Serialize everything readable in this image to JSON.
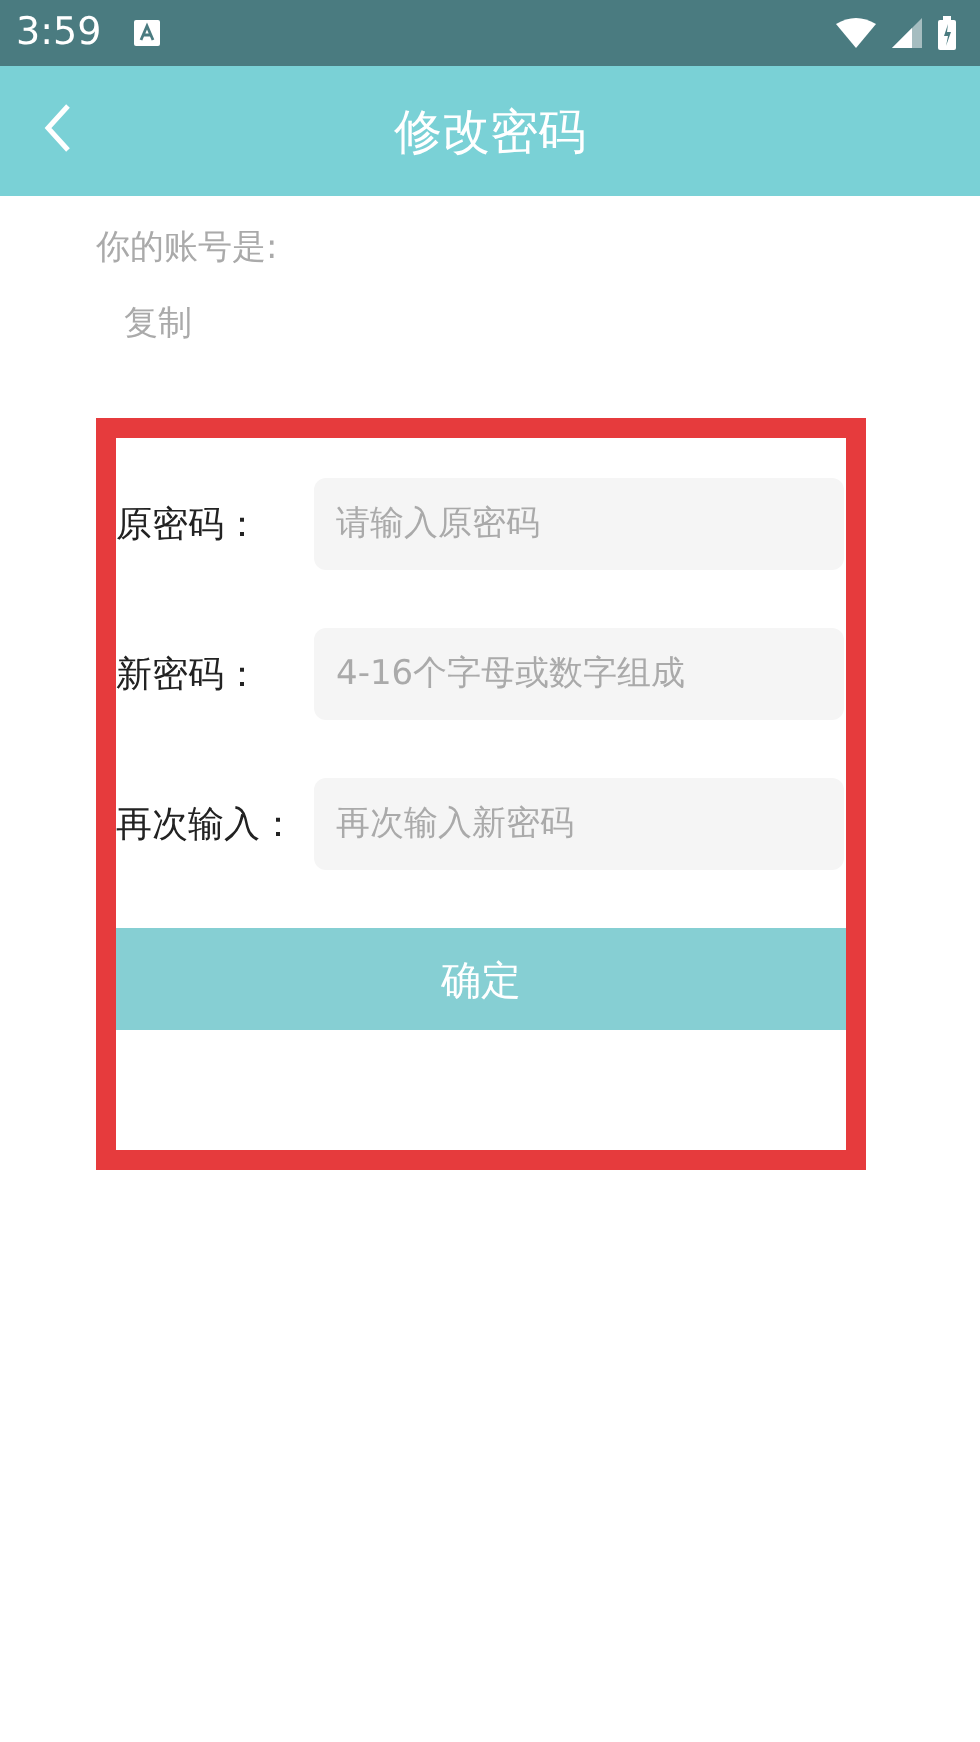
{
  "status_bar": {
    "time": "3:59"
  },
  "header": {
    "title": "修改密码"
  },
  "account_label": "你的账号是:",
  "copy_button": "复制",
  "fields": [
    {
      "label": "原密码：",
      "placeholder": "请输入原密码"
    },
    {
      "label": "新密码：",
      "placeholder": "4-16个字母或数字组成"
    },
    {
      "label": "再次输入：",
      "placeholder": "再次输入新密码"
    }
  ],
  "submit_button": "确定"
}
